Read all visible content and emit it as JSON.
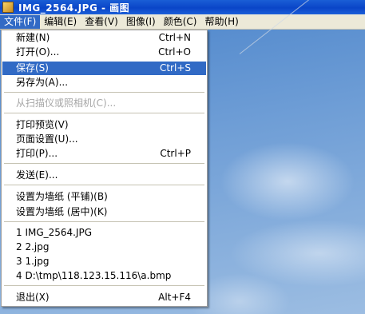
{
  "window": {
    "title": "IMG_2564.JPG - 画图"
  },
  "menubar": [
    {
      "label": "文件(F)"
    },
    {
      "label": "编辑(E)"
    },
    {
      "label": "查看(V)"
    },
    {
      "label": "图像(I)"
    },
    {
      "label": "颜色(C)"
    },
    {
      "label": "帮助(H)"
    }
  ],
  "file_menu": {
    "new": {
      "label": "新建(N)",
      "shortcut": "Ctrl+N"
    },
    "open": {
      "label": "打开(O)...",
      "shortcut": "Ctrl+O"
    },
    "save": {
      "label": "保存(S)",
      "shortcut": "Ctrl+S"
    },
    "save_as": {
      "label": "另存为(A)..."
    },
    "from_scanner": {
      "label": "从扫描仪或照相机(C)..."
    },
    "print_preview": {
      "label": "打印预览(V)"
    },
    "page_setup": {
      "label": "页面设置(U)..."
    },
    "print": {
      "label": "打印(P)...",
      "shortcut": "Ctrl+P"
    },
    "send": {
      "label": "发送(E)..."
    },
    "wallpaper_tile": {
      "label": "设置为墙纸 (平铺)(B)"
    },
    "wallpaper_center": {
      "label": "设置为墙纸 (居中)(K)"
    },
    "recent": [
      {
        "label": "1 IMG_2564.JPG"
      },
      {
        "label": "2 2.jpg"
      },
      {
        "label": "3 1.jpg"
      },
      {
        "label": "4 D:\\tmp\\118.123.15.116\\a.bmp"
      }
    ],
    "exit": {
      "label": "退出(X)",
      "shortcut": "Alt+F4"
    }
  }
}
